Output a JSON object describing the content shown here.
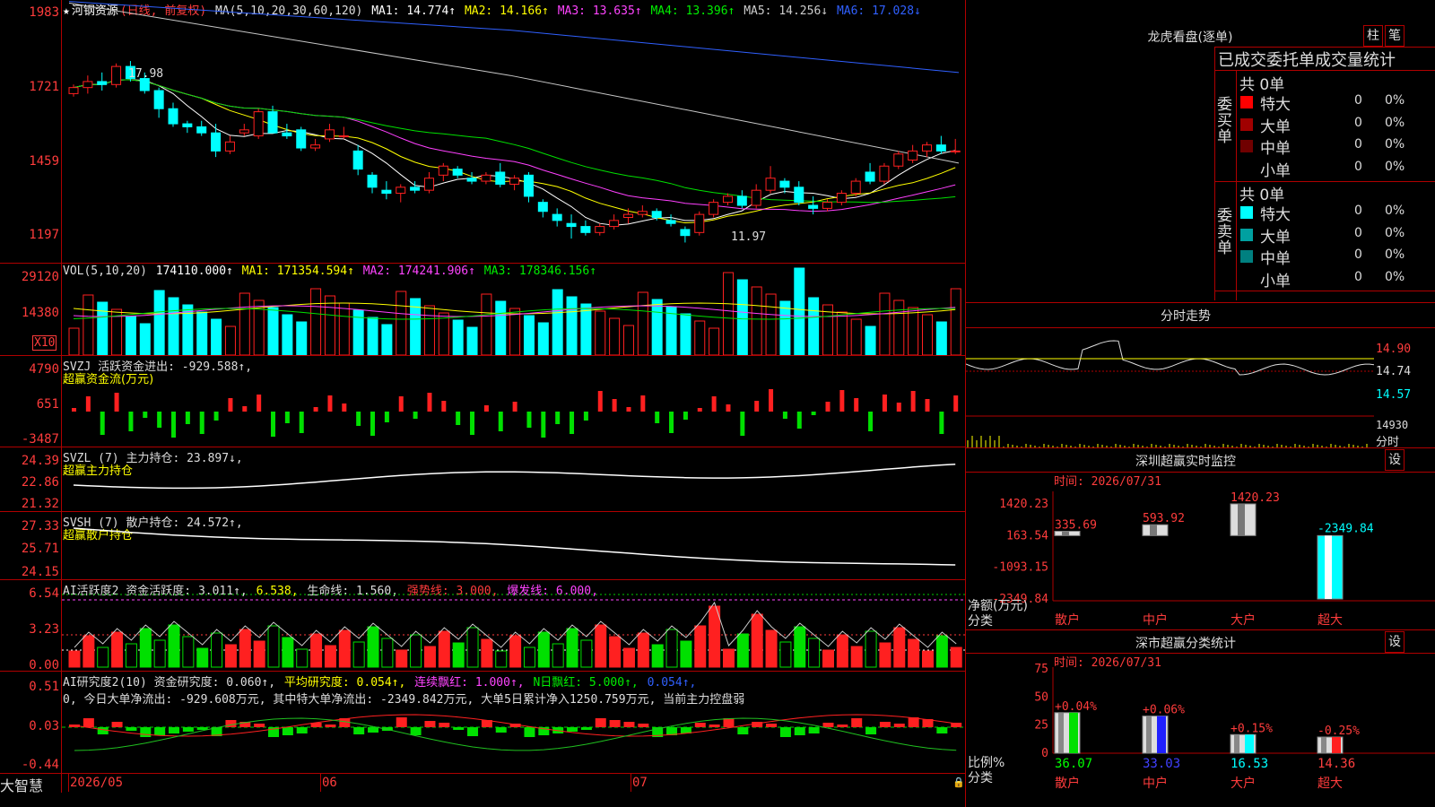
{
  "stock": {
    "name": "河钢资源",
    "mode": "(日线, 前复权)",
    "star": "★"
  },
  "kline": {
    "ma_params": "MA(5,10,20,30,60,120)",
    "ma": [
      {
        "label": "MA1: 14.774↑",
        "color": "#ffffff"
      },
      {
        "label": "MA2: 14.166↑",
        "color": "#ffff00"
      },
      {
        "label": "MA3: 13.635↑",
        "color": "#ff40ff"
      },
      {
        "label": "MA4: 13.396↑",
        "color": "#00e000"
      },
      {
        "label": "MA5: 14.256↓",
        "color": "#c8c8c8"
      },
      {
        "label": "MA6: 17.028↓",
        "color": "#3060ff"
      }
    ],
    "y_ticks": [
      "1983",
      "1721",
      "1459",
      "1197"
    ],
    "high_note": "17.98",
    "low_note": "11.97",
    "candles": [
      [
        16.9,
        17.2,
        16.8,
        17.1
      ],
      [
        17.1,
        17.5,
        16.9,
        17.3
      ],
      [
        17.3,
        17.6,
        17.0,
        17.2
      ],
      [
        17.2,
        17.9,
        17.1,
        17.8
      ],
      [
        17.8,
        17.98,
        17.3,
        17.4
      ],
      [
        17.4,
        17.6,
        16.9,
        17.0
      ],
      [
        17.0,
        17.1,
        16.1,
        16.4
      ],
      [
        16.4,
        16.6,
        15.8,
        15.9
      ],
      [
        15.9,
        16.0,
        15.6,
        15.8
      ],
      [
        15.8,
        16.0,
        15.5,
        15.6
      ],
      [
        15.6,
        15.9,
        14.8,
        15.0
      ],
      [
        15.0,
        15.5,
        14.9,
        15.3
      ],
      [
        15.6,
        15.9,
        15.5,
        15.7
      ],
      [
        15.5,
        16.4,
        15.4,
        16.3
      ],
      [
        16.3,
        16.5,
        15.6,
        15.6
      ],
      [
        15.6,
        15.9,
        15.4,
        15.5
      ],
      [
        15.7,
        15.8,
        15.0,
        15.1
      ],
      [
        15.1,
        15.4,
        15.0,
        15.2
      ],
      [
        15.4,
        15.9,
        15.3,
        15.7
      ],
      [
        15.5,
        15.8,
        15.4,
        15.5
      ],
      [
        15.0,
        15.2,
        14.2,
        14.4
      ],
      [
        14.2,
        14.3,
        13.6,
        13.8
      ],
      [
        13.7,
        14.0,
        13.4,
        13.6
      ],
      [
        13.6,
        13.9,
        13.3,
        13.8
      ],
      [
        13.8,
        14.0,
        13.6,
        13.7
      ],
      [
        13.7,
        14.3,
        13.6,
        14.1
      ],
      [
        14.2,
        14.6,
        14.0,
        14.5
      ],
      [
        14.4,
        14.5,
        14.1,
        14.2
      ],
      [
        14.1,
        14.3,
        13.9,
        14.0
      ],
      [
        14.0,
        14.3,
        13.9,
        14.2
      ],
      [
        14.3,
        14.6,
        13.8,
        13.9
      ],
      [
        13.9,
        14.2,
        13.7,
        14.1
      ],
      [
        14.2,
        14.3,
        13.3,
        13.5
      ],
      [
        13.3,
        13.4,
        12.8,
        13.0
      ],
      [
        12.9,
        13.1,
        12.5,
        12.7
      ],
      [
        12.6,
        12.9,
        12.1,
        12.5
      ],
      [
        12.5,
        12.7,
        12.2,
        12.3
      ],
      [
        12.3,
        12.6,
        12.2,
        12.5
      ],
      [
        12.5,
        12.9,
        12.4,
        12.7
      ],
      [
        12.8,
        13.1,
        12.6,
        12.9
      ],
      [
        12.9,
        13.2,
        12.8,
        13.0
      ],
      [
        13.0,
        13.1,
        12.7,
        12.8
      ],
      [
        12.7,
        12.9,
        12.5,
        12.6
      ],
      [
        12.4,
        12.5,
        11.97,
        12.2
      ],
      [
        12.3,
        13.0,
        12.2,
        12.9
      ],
      [
        12.9,
        13.4,
        12.8,
        13.3
      ],
      [
        13.3,
        13.6,
        13.2,
        13.5
      ],
      [
        13.5,
        13.7,
        13.1,
        13.2
      ],
      [
        13.2,
        13.9,
        13.1,
        13.7
      ],
      [
        13.7,
        14.5,
        13.6,
        14.1
      ],
      [
        14.0,
        14.1,
        13.6,
        13.8
      ],
      [
        13.8,
        14.0,
        13.2,
        13.3
      ],
      [
        13.2,
        13.5,
        12.9,
        13.1
      ],
      [
        13.1,
        13.4,
        13.0,
        13.3
      ],
      [
        13.3,
        13.7,
        13.2,
        13.6
      ],
      [
        13.6,
        14.1,
        13.5,
        14.0
      ],
      [
        14.3,
        14.6,
        13.9,
        14.0
      ],
      [
        14.0,
        14.6,
        13.9,
        14.5
      ],
      [
        14.5,
        15.0,
        14.4,
        14.9
      ],
      [
        14.7,
        15.2,
        14.6,
        15.0
      ],
      [
        15.0,
        15.3,
        14.8,
        15.2
      ],
      [
        15.2,
        15.5,
        14.9,
        15.0
      ],
      [
        15.0,
        15.4,
        14.9,
        15.0
      ]
    ]
  },
  "vol": {
    "label": "VOL(5,10,20)",
    "value": "174110.000↑",
    "ma1": "MA1: 171354.594↑",
    "ma2": "MA2: 174241.906↑",
    "ma3": "MA3: 178346.156↑",
    "y_ticks": [
      "29120",
      "14380"
    ],
    "unit": "X10"
  },
  "svzj": {
    "label": "SVZJ  活跃资金进出: -929.588↑,",
    "sub": "超赢资金流(万元)",
    "y_ticks": [
      "4790",
      "651",
      "-3487"
    ]
  },
  "svzl": {
    "label": "SVZL (7) 主力持仓: 23.897↓,",
    "sub": "超赢主力持仓",
    "y_ticks": [
      "24.39",
      "22.86",
      "21.32"
    ]
  },
  "svsh": {
    "label": "SVSH (7) 散户持仓: 24.572↑,",
    "sub": "超赢散户持仓",
    "y_ticks": [
      "27.33",
      "25.71",
      "24.15"
    ]
  },
  "ai_active": {
    "label": "AI活跃度2 资金活跃度: 3.011↑,",
    "v2": "6.538,",
    "life": "生命线: 1.560,",
    "strong": "强势线: 3.000,",
    "burst": "爆发线: 6.000,",
    "y_ticks": [
      "6.54",
      "3.23",
      "0.00"
    ]
  },
  "ai_research": {
    "label": "AI研究度2(10) 资金研究度: 0.060↑,",
    "avg": "平均研究度: 0.054↑,",
    "red": "连续飘红: 1.000↑,",
    "nred": "N日飘红: 5.000↑,",
    "last": "0.054↑,",
    "summary": "0, 今日大单净流出: -929.608万元, 其中特大单净流出: -2349.842万元, 大单5日累计净入1250.759万元, 当前主力控盘弱",
    "y_ticks": [
      "0.51",
      "0.03",
      "-0.44"
    ]
  },
  "bottom_axis": {
    "brand": "大智慧",
    "months": [
      "2026/05",
      "06",
      "07"
    ]
  },
  "lhb": {
    "title": "龙虎看盘(逐单)",
    "btn1": "柱",
    "btn2": "笔",
    "subtitle": "已成交委托单成交量统计",
    "buy_side": "委买单",
    "sell_side": "委卖单",
    "buy_total": "共 0单",
    "sell_total": "共 0单",
    "buy_rows": [
      {
        "label": "特大",
        "count": "0",
        "pct": "0%",
        "color": "#ff0000"
      },
      {
        "label": "大单",
        "count": "0",
        "pct": "0%",
        "color": "#a00000"
      },
      {
        "label": "中单",
        "count": "0",
        "pct": "0%",
        "color": "#700000"
      },
      {
        "label": "小单",
        "count": "0",
        "pct": "0%",
        "color": "#000000"
      }
    ],
    "sell_rows": [
      {
        "label": "特大",
        "count": "0",
        "pct": "0%",
        "color": "#00ffff"
      },
      {
        "label": "大单",
        "count": "0",
        "pct": "0%",
        "color": "#00a0a0"
      },
      {
        "label": "中单",
        "count": "0",
        "pct": "0%",
        "color": "#008080"
      },
      {
        "label": "小单",
        "count": "0",
        "pct": "0%",
        "color": "#000000"
      }
    ]
  },
  "intraday": {
    "title": "分时走势",
    "y_ticks": [
      "14.90",
      "14.74",
      "14.57"
    ],
    "vol_tick": "14930",
    "unit": "分时"
  },
  "sz_monitor": {
    "title": "深圳超赢实时监控",
    "btn": "设",
    "time": "时间: 2026/07/31",
    "y_ticks": [
      "1420.23",
      "163.54",
      "-1093.15",
      "-2349.84"
    ],
    "ylabel": "净额(万元)",
    "xlabel": "分类",
    "categories": [
      "散户",
      "中户",
      "大户",
      "超大"
    ],
    "values": [
      335.69,
      593.92,
      1420.23,
      -2349.84
    ],
    "value_labels": [
      "335.69",
      "593.92",
      "1420.23",
      "-2349.84"
    ]
  },
  "sz_stats": {
    "title": "深市超赢分类统计",
    "btn": "设",
    "time": "时间: 2026/07/31",
    "y_ticks": [
      "75",
      "50",
      "25",
      "0"
    ],
    "ylabel": "比例%",
    "xlabel": "分类",
    "categories": [
      "散户",
      "中户",
      "大户",
      "超大"
    ],
    "values": [
      36.07,
      33.03,
      16.53,
      14.36
    ],
    "value_labels": [
      "36.07",
      "33.03",
      "16.53",
      "14.36"
    ],
    "changes": [
      "+0.04%",
      "+0.06%",
      "+0.15%",
      "-0.25%"
    ],
    "value_colors": [
      "#00ff00",
      "#4040ff",
      "#00ffff",
      "#ff4040"
    ]
  },
  "chart_data": [
    {
      "type": "bar",
      "title": "深圳超赢实时监控",
      "categories": [
        "散户",
        "中户",
        "大户",
        "超大"
      ],
      "values": [
        335.69,
        593.92,
        1420.23,
        -2349.84
      ],
      "ylabel": "净额(万元)",
      "ylim": [
        -2349.84,
        1420.23
      ]
    },
    {
      "type": "bar",
      "title": "深市超赢分类统计",
      "categories": [
        "散户",
        "中户",
        "大户",
        "超大"
      ],
      "values": [
        36.07,
        33.03,
        16.53,
        14.36
      ],
      "ylabel": "比例%",
      "ylim": [
        0,
        75
      ]
    }
  ]
}
